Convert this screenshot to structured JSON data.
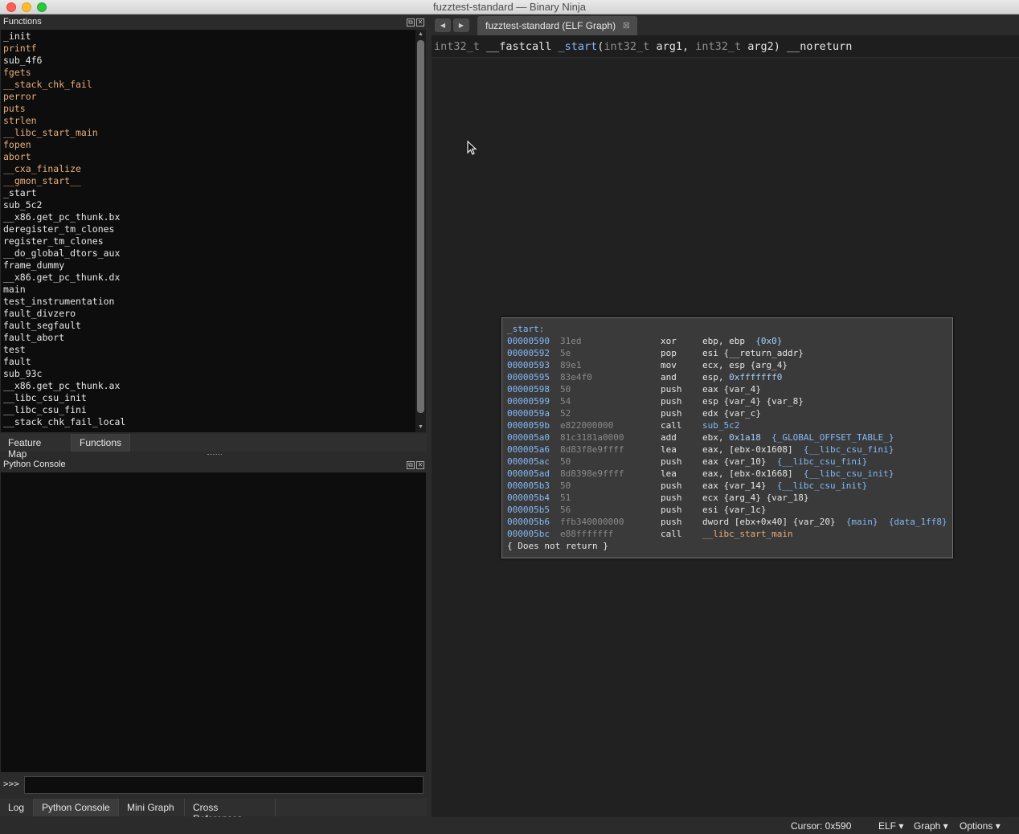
{
  "window": {
    "title": "fuzztest-standard — Binary Ninja",
    "traffic_lights": [
      "#fe5f57",
      "#febc2e",
      "#28c840"
    ]
  },
  "functions_panel": {
    "title": "Functions",
    "items": [
      {
        "name": "_init",
        "color": "white"
      },
      {
        "name": "printf",
        "color": "orange"
      },
      {
        "name": "sub_4f6",
        "color": "white"
      },
      {
        "name": "fgets",
        "color": "orange"
      },
      {
        "name": "__stack_chk_fail",
        "color": "orange"
      },
      {
        "name": "perror",
        "color": "orange"
      },
      {
        "name": "puts",
        "color": "orange"
      },
      {
        "name": "strlen",
        "color": "orange"
      },
      {
        "name": "__libc_start_main",
        "color": "orange"
      },
      {
        "name": "fopen",
        "color": "orange"
      },
      {
        "name": "abort",
        "color": "orange"
      },
      {
        "name": "__cxa_finalize",
        "color": "orange"
      },
      {
        "name": "__gmon_start__",
        "color": "orange"
      },
      {
        "name": "_start",
        "color": "white"
      },
      {
        "name": "sub_5c2",
        "color": "white"
      },
      {
        "name": "__x86.get_pc_thunk.bx",
        "color": "white"
      },
      {
        "name": "deregister_tm_clones",
        "color": "white"
      },
      {
        "name": "register_tm_clones",
        "color": "white"
      },
      {
        "name": "__do_global_dtors_aux",
        "color": "white"
      },
      {
        "name": "frame_dummy",
        "color": "white"
      },
      {
        "name": "__x86.get_pc_thunk.dx",
        "color": "white"
      },
      {
        "name": "main",
        "color": "white"
      },
      {
        "name": "test_instrumentation",
        "color": "white"
      },
      {
        "name": "fault_divzero",
        "color": "white"
      },
      {
        "name": "fault_segfault",
        "color": "white"
      },
      {
        "name": "fault_abort",
        "color": "white"
      },
      {
        "name": "test",
        "color": "white"
      },
      {
        "name": "fault",
        "color": "white"
      },
      {
        "name": "sub_93c",
        "color": "white"
      },
      {
        "name": "__x86.get_pc_thunk.ax",
        "color": "white"
      },
      {
        "name": "__libc_csu_init",
        "color": "white"
      },
      {
        "name": "__libc_csu_fini",
        "color": "white"
      },
      {
        "name": "__stack_chk_fail_local",
        "color": "white"
      }
    ],
    "tabs": [
      "Feature Map",
      "Functions"
    ],
    "active_tab": "Functions"
  },
  "console_panel": {
    "title": "Python Console",
    "prompt": ">>>",
    "input_value": "",
    "tabs": [
      "Log",
      "Python Console",
      "Mini Graph",
      "Cross References"
    ],
    "active_tab": "Python Console"
  },
  "editor": {
    "tab_label": "fuzztest-standard (ELF Graph)",
    "signature": {
      "ret_type": "int32_t",
      "convention": "__fastcall",
      "name": "_start",
      "open_paren": "(",
      "p1_type": "int32_t",
      "p1_name": "arg1,",
      "p2_type": "int32_t",
      "p2_name": "arg2)",
      "suffix": "__noreturn"
    },
    "block": {
      "label": "_start:",
      "instructions": [
        {
          "addr": "00000590",
          "bytes": "31ed",
          "mnemonic": "xor",
          "operands": [
            {
              "t": "ebp, ebp  "
            },
            {
              "t": "{0x0}",
              "c": "imm"
            }
          ]
        },
        {
          "addr": "00000592",
          "bytes": "5e",
          "mnemonic": "pop",
          "operands": [
            {
              "t": "esi {__return_addr}"
            }
          ]
        },
        {
          "addr": "00000593",
          "bytes": "89e1",
          "mnemonic": "mov",
          "operands": [
            {
              "t": "ecx, esp {arg_4}"
            }
          ]
        },
        {
          "addr": "00000595",
          "bytes": "83e4f0",
          "mnemonic": "and",
          "operands": [
            {
              "t": "esp, "
            },
            {
              "t": "0xfffffff0",
              "c": "imm"
            }
          ]
        },
        {
          "addr": "00000598",
          "bytes": "50",
          "mnemonic": "push",
          "operands": [
            {
              "t": "eax {var_4}"
            }
          ]
        },
        {
          "addr": "00000599",
          "bytes": "54",
          "mnemonic": "push",
          "operands": [
            {
              "t": "esp {var_4} {var_8}"
            }
          ]
        },
        {
          "addr": "0000059a",
          "bytes": "52",
          "mnemonic": "push",
          "operands": [
            {
              "t": "edx {var_c}"
            }
          ]
        },
        {
          "addr": "0000059b",
          "bytes": "e822000000",
          "mnemonic": "call",
          "operands": [
            {
              "t": "sub_5c2",
              "c": "call"
            }
          ]
        },
        {
          "addr": "000005a0",
          "bytes": "81c3181a0000",
          "mnemonic": "add",
          "operands": [
            {
              "t": "ebx, "
            },
            {
              "t": "0x1a18",
              "c": "imm"
            },
            {
              "t": "  "
            },
            {
              "t": "{_GLOBAL_OFFSET_TABLE_}",
              "c": "sym"
            }
          ]
        },
        {
          "addr": "000005a6",
          "bytes": "8d83f8e9ffff",
          "mnemonic": "lea",
          "operands": [
            {
              "t": "eax, [ebx-0x1608]  "
            },
            {
              "t": "{__libc_csu_fini}",
              "c": "sym"
            }
          ]
        },
        {
          "addr": "000005ac",
          "bytes": "50",
          "mnemonic": "push",
          "operands": [
            {
              "t": "eax {var_10}  "
            },
            {
              "t": "{__libc_csu_fini}",
              "c": "sym"
            }
          ]
        },
        {
          "addr": "000005ad",
          "bytes": "8d8398e9ffff",
          "mnemonic": "lea",
          "operands": [
            {
              "t": "eax, [ebx-0x1668]  "
            },
            {
              "t": "{__libc_csu_init}",
              "c": "sym"
            }
          ]
        },
        {
          "addr": "000005b3",
          "bytes": "50",
          "mnemonic": "push",
          "operands": [
            {
              "t": "eax {var_14}  "
            },
            {
              "t": "{__libc_csu_init}",
              "c": "sym"
            }
          ]
        },
        {
          "addr": "000005b4",
          "bytes": "51",
          "mnemonic": "push",
          "operands": [
            {
              "t": "ecx {arg_4} {var_18}"
            }
          ]
        },
        {
          "addr": "000005b5",
          "bytes": "56",
          "mnemonic": "push",
          "operands": [
            {
              "t": "esi {var_1c}"
            }
          ]
        },
        {
          "addr": "000005b6",
          "bytes": "ffb340000000",
          "mnemonic": "push",
          "operands": [
            {
              "t": "dword [ebx+0x40] {var_20}  "
            },
            {
              "t": "{main}",
              "c": "sym"
            },
            {
              "t": "  "
            },
            {
              "t": "{data_1ff8}",
              "c": "sym"
            }
          ]
        },
        {
          "addr": "000005bc",
          "bytes": "e88fffffff",
          "mnemonic": "call",
          "operands": [
            {
              "t": "__libc_start_main",
              "c": "ext"
            }
          ]
        }
      ],
      "footer": "{ Does not return }"
    }
  },
  "status_bar": {
    "cursor": "Cursor: 0x590",
    "file_type": "ELF ▾",
    "view": "Graph ▾",
    "options": "Options ▾"
  },
  "colors": {
    "background": "#212121",
    "accent_blue": "#84b8f5",
    "import_orange": "#e7ae7d"
  }
}
